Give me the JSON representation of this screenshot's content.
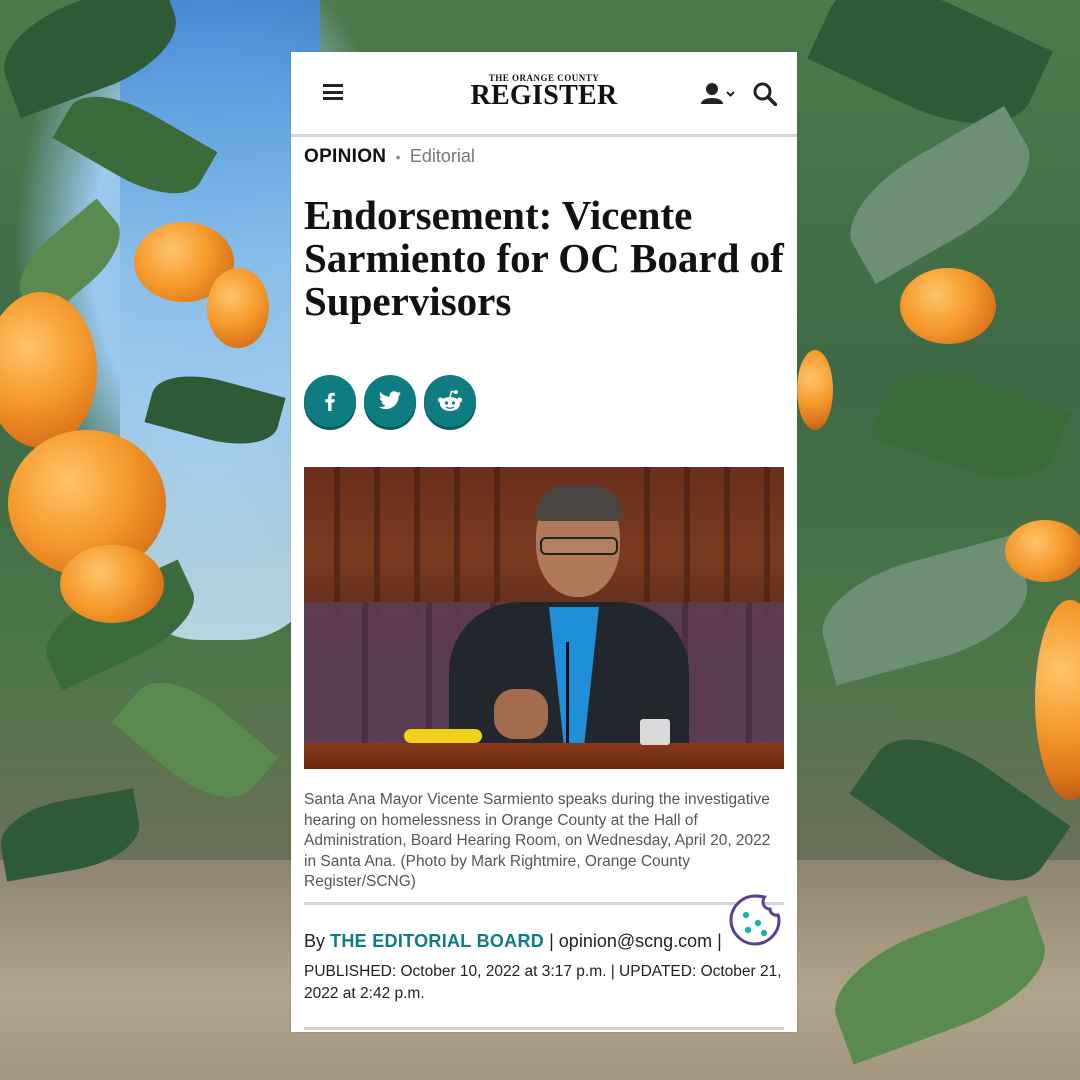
{
  "site": {
    "logo_small": "THE ORANGE COUNTY",
    "logo_big": "REGISTER"
  },
  "header": {
    "icons": [
      "menu-icon",
      "account-icon",
      "chevron-down-icon",
      "search-icon"
    ]
  },
  "article": {
    "section": "OPINION",
    "separator": "•",
    "subsection": "Editorial",
    "headline": "Endorsement: Vicente Sarmiento for OC Board of Supervisors",
    "share": [
      {
        "name": "facebook",
        "icon": "facebook-icon"
      },
      {
        "name": "twitter",
        "icon": "twitter-icon"
      },
      {
        "name": "reddit",
        "icon": "reddit-icon"
      }
    ],
    "caption": "Santa Ana Mayor Vicente Sarmiento speaks during the investigative hearing on homelessness in Orange County at the Hall of Administration, Board Hearing Room, on Wednesday, April 20, 2022 in Santa Ana. (Photo by Mark Rightmire, Orange County Register/SCNG)",
    "byline": {
      "by": "By",
      "author": "THE EDITORIAL BOARD",
      "pipe": "|",
      "email": "opinion@scng.com",
      "pipe_end": "|"
    },
    "dates": "PUBLISHED: October 10, 2022 at 3:17 p.m. | UPDATED: October 21, 2022 at 2:42 p.m."
  },
  "colors": {
    "accent": "#0e7c80",
    "text": "#111111",
    "caption": "#555555",
    "divider": "#d4d4d4"
  },
  "overlay": {
    "cookie_icon": "cookie-icon"
  }
}
